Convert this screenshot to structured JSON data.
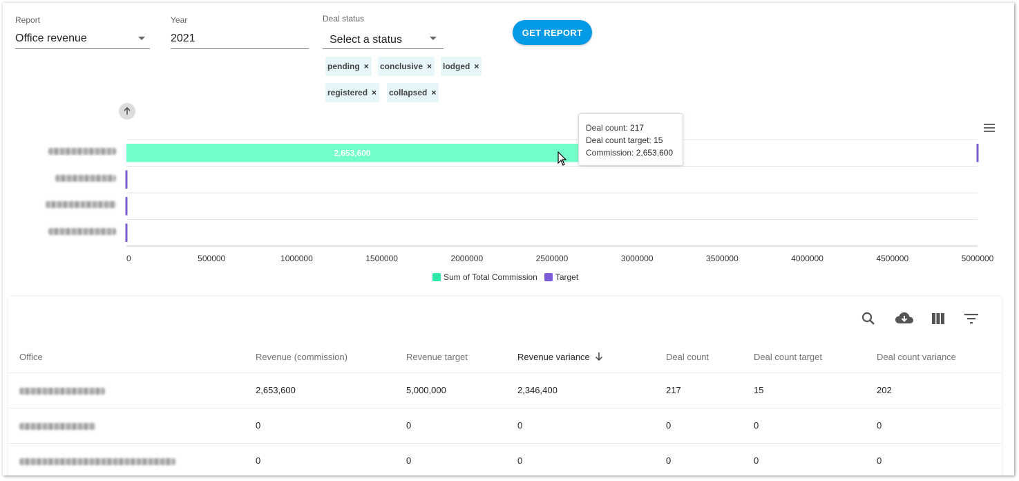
{
  "filters": {
    "report": {
      "label": "Report",
      "value": "Office revenue"
    },
    "year": {
      "label": "Year",
      "value": "2021"
    },
    "deal_status": {
      "label": "Deal status",
      "placeholder": "Select a status"
    },
    "get_report_label": "GET REPORT",
    "chips": [
      "pending",
      "conclusive",
      "lodged",
      "registered",
      "collapsed"
    ]
  },
  "chart_data": {
    "type": "bar",
    "orientation": "horizontal",
    "categories": [
      "",
      "",
      "",
      ""
    ],
    "series": [
      {
        "name": "Sum of Total Commission",
        "values": [
          2653600,
          0,
          0,
          0
        ],
        "color": "#72ffc9"
      },
      {
        "name": "Target",
        "values": [
          5000000,
          0,
          0,
          0
        ],
        "color": "#7b5cd6"
      }
    ],
    "bar_label": "2,653,600",
    "xlim": [
      0,
      5000000
    ],
    "xticks": [
      "0",
      "500000",
      "1000000",
      "1500000",
      "2000000",
      "2500000",
      "3000000",
      "3500000",
      "4000000",
      "4500000",
      "5000000"
    ],
    "grid": true,
    "legend": "bottom"
  },
  "tooltip": {
    "lines": [
      {
        "key": "Deal count:",
        "value": "217"
      },
      {
        "key": "Deal count target:",
        "value": "15"
      },
      {
        "key": "Commission:",
        "value": "2,653,600"
      }
    ]
  },
  "table": {
    "toolbar_icons": [
      "search-icon",
      "cloud-download-icon",
      "view-columns-icon",
      "filter-icon"
    ],
    "columns": [
      "Office",
      "Revenue (commission)",
      "Revenue target",
      "Revenue variance",
      "Deal count",
      "Deal count target",
      "Deal count variance"
    ],
    "sorted_column": "Revenue variance",
    "rows": [
      [
        "",
        "2,653,600",
        "5,000,000",
        "2,346,400",
        "217",
        "15",
        "202"
      ],
      [
        "",
        "0",
        "0",
        "0",
        "0",
        "0",
        "0"
      ],
      [
        "",
        "0",
        "0",
        "0",
        "0",
        "0",
        "0"
      ]
    ]
  },
  "colors": {
    "accent": "#039be5",
    "commission": "#72ffc9",
    "target": "#7b5cd6",
    "chip_bg": "#e7f7f9"
  }
}
